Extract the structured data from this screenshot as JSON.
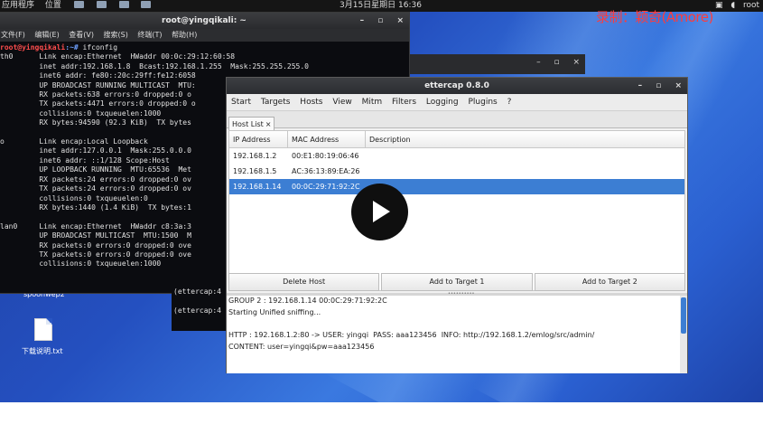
{
  "top_panel": {
    "menu": [
      "应用程序",
      "位置"
    ],
    "clock": "3月15日星期日 16:36",
    "user": "root"
  },
  "watermark": "录制：颖奇(Amore)",
  "terminal": {
    "title": "root@yingqikali: ~",
    "controls": [
      "–",
      "▫",
      "×"
    ],
    "menu": [
      "文件(F)",
      "编辑(E)",
      "查看(V)",
      "搜索(S)",
      "终端(T)",
      "帮助(H)"
    ],
    "prompt_user": "root@yingqikali",
    "prompt_path": ":~#",
    "command": "ifconfig",
    "output": "th0      Link encap:Ethernet  HWaddr 00:0c:29:12:60:58\n         inet addr:192.168.1.8  Bcast:192.168.1.255  Mask:255.255.255.0\n         inet6 addr: fe80::20c:29ff:fe12:6058\n         UP BROADCAST RUNNING MULTICAST  MTU:\n         RX packets:638 errors:0 dropped:0 o\n         TX packets:4471 errors:0 dropped:0 o\n         collisions:0 txqueuelen:1000\n         RX bytes:94590 (92.3 KiB)  TX bytes\n\no        Link encap:Local Loopback\n         inet addr:127.0.0.1  Mask:255.0.0.0\n         inet6 addr: ::1/128 Scope:Host\n         UP LOOPBACK RUNNING  MTU:65536  Met\n         RX packets:24 errors:0 dropped:0 ov\n         TX packets:24 errors:0 dropped:0 ov\n         collisions:0 txqueuelen:0\n         RX bytes:1440 (1.4 KiB)  TX bytes:1\n\nlan0     Link encap:Ethernet  HWaddr c8:3a:3\n         UP BROADCAST MULTICAST  MTU:1500  M\n         RX packets:0 errors:0 dropped:0 ove\n         TX packets:0 errors:0 dropped:0 ove\n         collisions:0 txqueuelen:1000",
    "second_lines": "(ettercap:4\n\n(ettercap:4"
  },
  "background_window": {
    "controls": [
      "–",
      "▫",
      "×"
    ]
  },
  "ettercap": {
    "title": "ettercap 0.8.0",
    "controls": [
      "–",
      "▫",
      "×"
    ],
    "menu": [
      "Start",
      "Targets",
      "Hosts",
      "View",
      "Mitm",
      "Filters",
      "Logging",
      "Plugins",
      "?"
    ],
    "tab": {
      "label": "Host List",
      "close": "×"
    },
    "columns": [
      "IP Address",
      "MAC Address",
      "Description"
    ],
    "hosts": [
      {
        "ip": "192.168.1.2",
        "mac": "00:E1:80:19:06:46",
        "desc": ""
      },
      {
        "ip": "192.168.1.5",
        "mac": "AC:36:13:89:EA:26",
        "desc": ""
      },
      {
        "ip": "192.168.1.14",
        "mac": "00:0C:29:71:92:2C",
        "desc": ""
      }
    ],
    "buttons": [
      "Delete Host",
      "Add to Target 1",
      "Add to Target 2"
    ],
    "log": "GROUP 2 : 192.168.1.14 00:0C:29:71:92:2C\nStarting Unified sniffing...\n\nHTTP : 192.168.1.2:80 -> USER: yingqi  PASS: aaa123456  INFO: http://192.168.1.2/emlog/src/admin/\nCONTENT: user=yingqi&pw=aaa123456"
  },
  "desktop": {
    "icon1_label": "spoonwep2",
    "icon2_label": "下载说明.txt"
  }
}
